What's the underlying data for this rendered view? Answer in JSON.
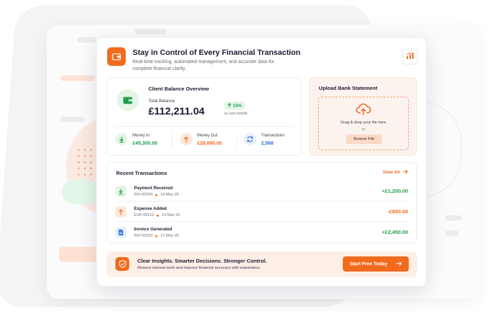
{
  "header": {
    "title": "Stay in Control of Every Financial Transaction",
    "subtitle": "Real-time tracking, automated management, and accurate data for complete financial clarity.",
    "icon": "wallet-icon",
    "action_icon": "chart-icon"
  },
  "balance": {
    "heading": "Client Balance Overview",
    "total_label": "Total Balance",
    "total_value": "£112,211.04",
    "change": "15%",
    "change_note": "vs last month",
    "metrics": [
      {
        "label": "Money In",
        "value": "£45,300.00",
        "icon": "arrow-down-icon",
        "color": "#1f9d48"
      },
      {
        "label": "Money Out",
        "value": "£28,690.00",
        "icon": "arrow-up-icon",
        "color": "#f26a1b"
      },
      {
        "label": "Transactions",
        "value": "2,568",
        "icon": "refresh-icon",
        "color": "#2f6fdc"
      }
    ]
  },
  "upload": {
    "title": "Upload Bank Statement",
    "drop_text": "Drag & drop your file here",
    "or_text": "or",
    "browse_label": "Browse File"
  },
  "transactions": {
    "heading": "Recent Transactions",
    "view_all": "View All",
    "rows": [
      {
        "name": "Payment Received",
        "ref": "INV-00234",
        "date": "14 May 26",
        "amount": "+£1,200.00",
        "icon": "download-icon",
        "color": "#1f9d48"
      },
      {
        "name": "Expense Added",
        "ref": "EXP-00112",
        "date": "13 May 26",
        "amount": "-£850.00",
        "icon": "arrow-up-icon",
        "color": "#f26a1b"
      },
      {
        "name": "Invoice Generated",
        "ref": "INV-00233",
        "date": "12 May 26",
        "amount": "+£2,450.00",
        "icon": "document-icon",
        "color": "#1f9d48"
      }
    ]
  },
  "footer": {
    "title": "Clear Insights. Smarter Decisions. Stronger Control.",
    "subtitle": "Reduce manual work and improve financial accuracy with automation.",
    "cta_label": "Start Free Today"
  },
  "colors": {
    "accent": "#f26a1b",
    "positive": "#1f9d48",
    "info": "#2f6fdc"
  }
}
